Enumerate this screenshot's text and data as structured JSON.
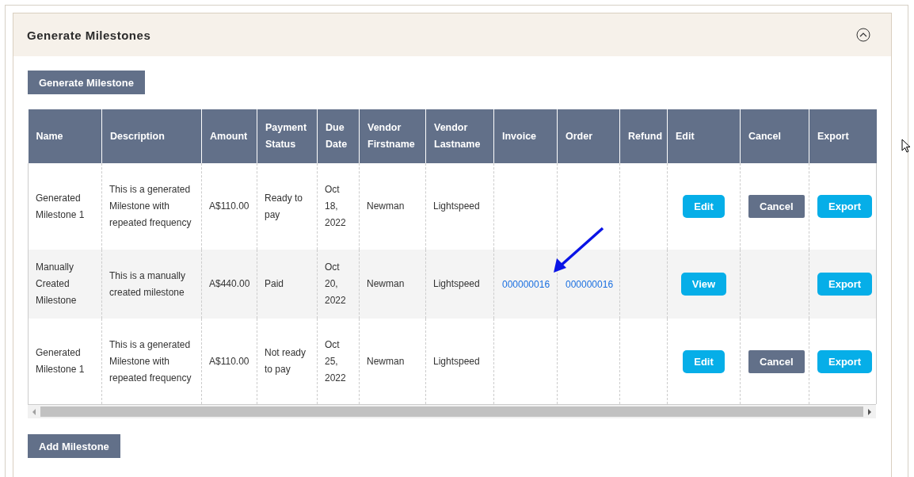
{
  "panel": {
    "title": "Generate Milestones",
    "expanded": true
  },
  "generate_button": "Generate Milestone",
  "table": {
    "columns": [
      "Name",
      "Description",
      "Amount",
      "Payment Status",
      "Due Date",
      "Vendor Firstname",
      "Vendor Lastname",
      "Invoice",
      "Order",
      "Refund",
      "Edit",
      "Cancel",
      "Export"
    ],
    "rows": [
      {
        "name": "Generated Milestone 1",
        "description": "This is a generated Milestone with repeated frequency",
        "amount": "A$110.00",
        "payment_status": "Ready to pay",
        "due_date": "Oct 18, 2022",
        "vendor_firstname": "Newman",
        "vendor_lastname": "Lightspeed",
        "edit": {
          "label": "Edit"
        },
        "cancel": {
          "label": "Cancel"
        },
        "export": {
          "label": "Export"
        }
      },
      {
        "name": "Manually Created Milestone",
        "description": "This is a manually created milestone",
        "amount": "A$440.00",
        "payment_status": "Paid",
        "due_date": "Oct 20, 2022",
        "vendor_firstname": "Newman",
        "vendor_lastname": "Lightspeed",
        "invoice": "000000016",
        "order": "000000016",
        "edit": {
          "label": "View"
        },
        "export": {
          "label": "Export"
        }
      },
      {
        "name": "Generated Milestone 1",
        "description": "This is a generated Milestone with repeated frequency",
        "amount": "A$110.00",
        "payment_status": "Not ready to pay",
        "due_date": "Oct 25, 2022",
        "vendor_firstname": "Newman",
        "vendor_lastname": "Lightspeed",
        "edit": {
          "label": "Edit"
        },
        "cancel": {
          "label": "Cancel"
        },
        "export": {
          "label": "Export"
        }
      }
    ]
  },
  "add_button": "Add Milestone"
}
